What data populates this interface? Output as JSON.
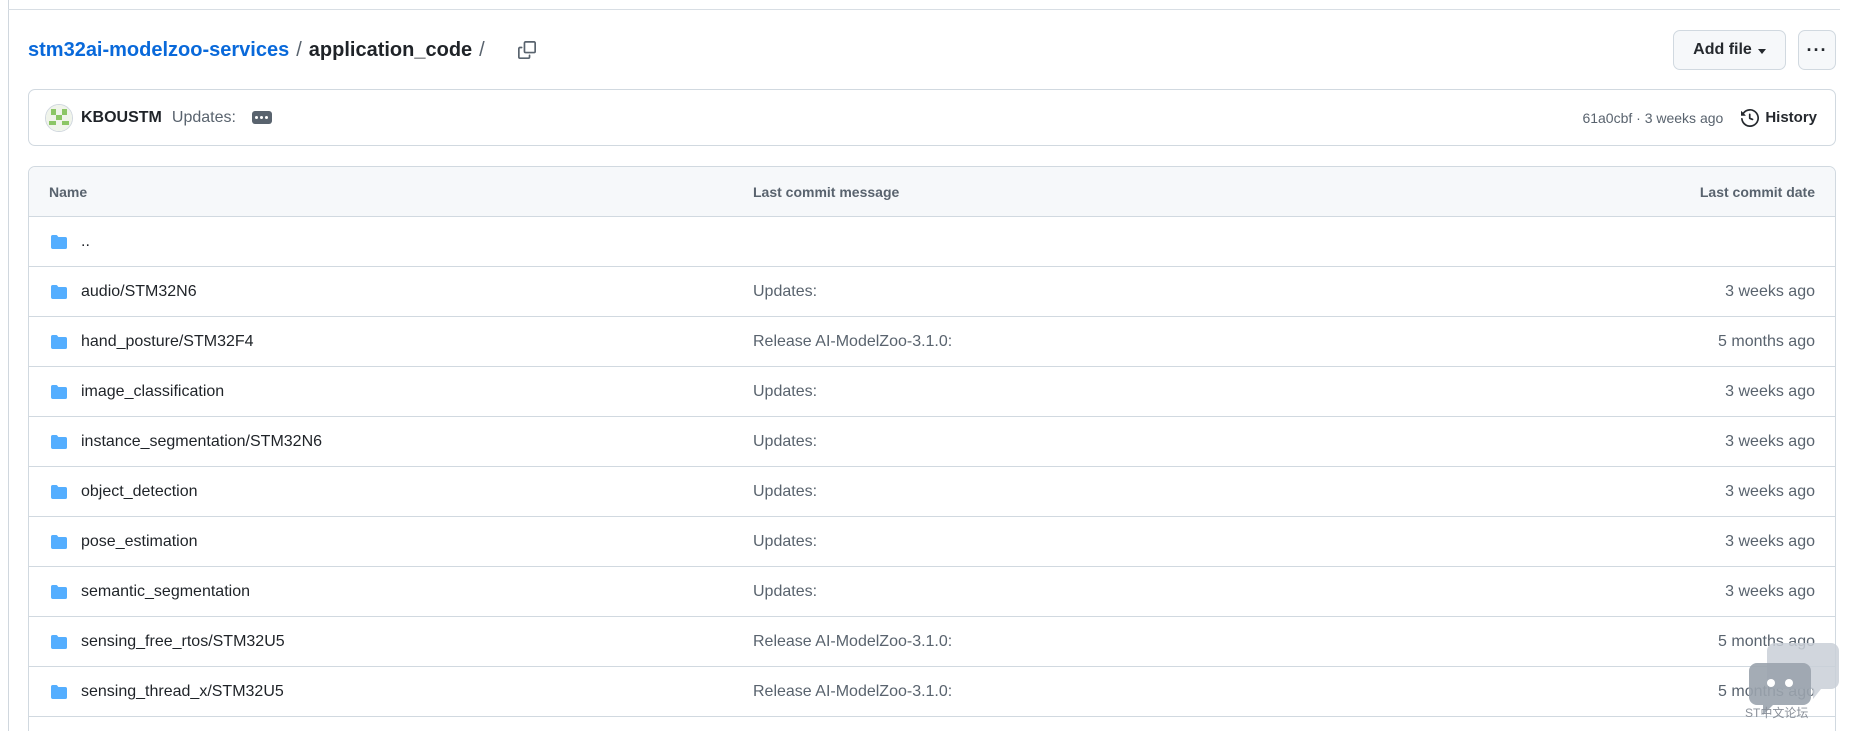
{
  "breadcrumb": {
    "repo": "stm32ai-modelzoo-services",
    "separator": "/",
    "current": "application_code",
    "trailing_separator": "/"
  },
  "header": {
    "add_file_label": "Add file",
    "more_label": "···"
  },
  "latest_commit": {
    "author": "KBOUSTM",
    "message": "Updates:",
    "sha_time": "61a0cbf · 3 weeks ago",
    "history_label": "History"
  },
  "table": {
    "columns": {
      "name": "Name",
      "message": "Last commit message",
      "date": "Last commit date"
    },
    "parent_dir": "..",
    "rows": [
      {
        "name": "audio/STM32N6",
        "message": "Updates:",
        "date": "3 weeks ago"
      },
      {
        "name": "hand_posture/STM32F4",
        "message": "Release AI-ModelZoo-3.1.0:",
        "date": "5 months ago"
      },
      {
        "name": "image_classification",
        "message": "Updates:",
        "date": "3 weeks ago"
      },
      {
        "name": "instance_segmentation/STM32N6",
        "message": "Updates:",
        "date": "3 weeks ago"
      },
      {
        "name": "object_detection",
        "message": "Updates:",
        "date": "3 weeks ago"
      },
      {
        "name": "pose_estimation",
        "message": "Updates:",
        "date": "3 weeks ago"
      },
      {
        "name": "semantic_segmentation",
        "message": "Updates:",
        "date": "3 weeks ago"
      },
      {
        "name": "sensing_free_rtos/STM32U5",
        "message": "Release AI-ModelZoo-3.1.0:",
        "date": "5 months ago"
      },
      {
        "name": "sensing_thread_x/STM32U5",
        "message": "Release AI-ModelZoo-3.1.0:",
        "date": "5 months ago"
      }
    ]
  },
  "watermark": {
    "text": "ST中文论坛"
  },
  "colors": {
    "link": "#0969da",
    "folder": "#54aeff",
    "muted": "#59636e",
    "border": "#d1d9e0",
    "header_bg": "#f6f8fa"
  }
}
